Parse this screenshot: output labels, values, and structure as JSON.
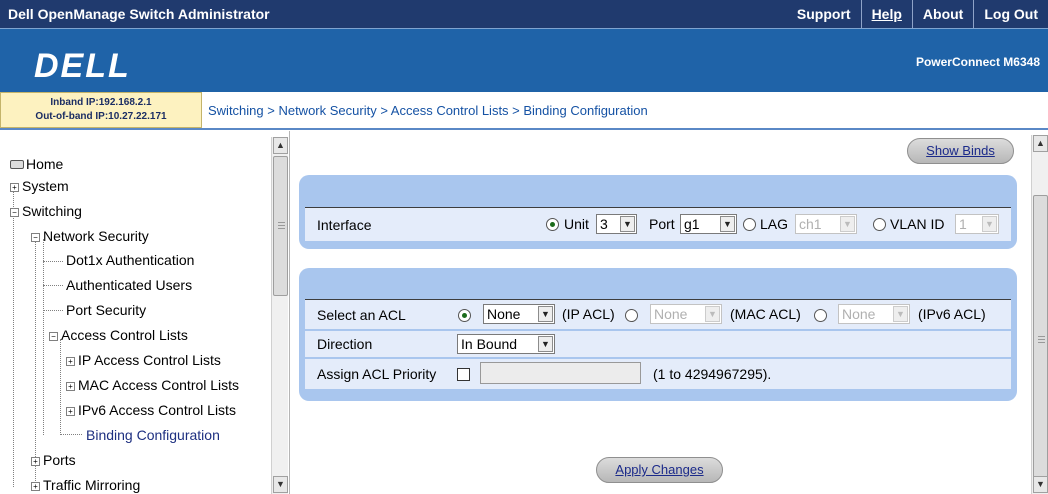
{
  "header": {
    "app_title": "Dell OpenManage Switch Administrator",
    "links": [
      "Support",
      "Help",
      "About",
      "Log Out"
    ],
    "logo": "DELL",
    "product": "PowerConnect M6348"
  },
  "info": {
    "inband": "Inband IP:192.168.2.1",
    "outofband": "Out-of-band IP:10.27.22.171",
    "breadcrumb": "Switching > Network Security > Access Control Lists > Binding Configuration"
  },
  "nav": {
    "home": "Home",
    "system": "System",
    "switching": "Switching",
    "network_security": "Network Security",
    "dot1x": "Dot1x Authentication",
    "auth_users": "Authenticated Users",
    "port_security": "Port Security",
    "acl": "Access Control Lists",
    "ip_acl": "IP Access Control Lists",
    "mac_acl": "MAC Access Control Lists",
    "ipv6_acl": "IPv6 Access Control Lists",
    "binding": "Binding Configuration",
    "ports": "Ports",
    "traffic_mirroring": "Traffic Mirroring"
  },
  "main": {
    "show_binds": "Show Binds",
    "interface_label": "Interface",
    "unit_label": "Unit",
    "unit_value": "3",
    "port_label": "Port",
    "port_value": "g1",
    "lag_label": "LAG",
    "lag_value": "ch1",
    "vlan_label": "VLAN ID",
    "vlan_value": "1",
    "select_acl_label": "Select an ACL",
    "ip_acl_value": "None",
    "ip_acl_label": "(IP ACL)",
    "mac_acl_value": "None",
    "mac_acl_label": "(MAC ACL)",
    "ipv6_acl_value": "None",
    "ipv6_acl_label": "(IPv6 ACL)",
    "direction_label": "Direction",
    "direction_value": "In Bound",
    "priority_label": "Assign ACL Priority",
    "priority_range": "(1 to 4294967295).",
    "apply": "Apply Changes"
  }
}
